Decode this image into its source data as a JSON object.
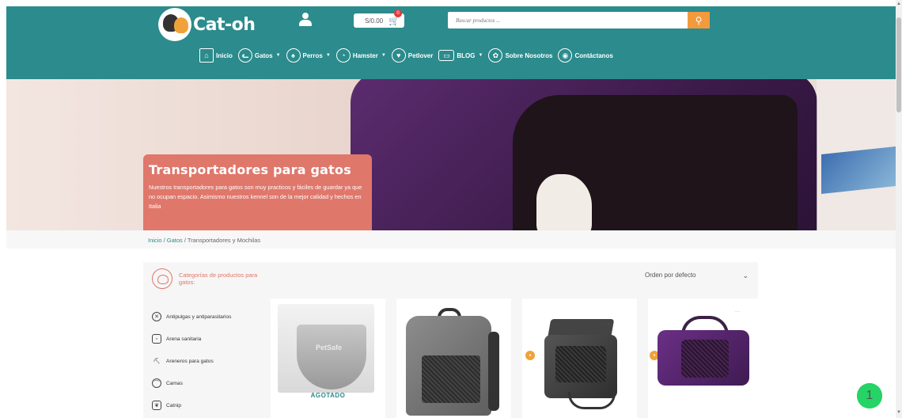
{
  "header": {
    "logo_text": "Cat-oh",
    "cart_total": "S/0.00",
    "cart_count": "0",
    "search_placeholder": "Buscar productos ...",
    "nav": [
      {
        "label": "Inicio",
        "icon": "house-icon",
        "has_dropdown": false
      },
      {
        "label": "Gatos",
        "icon": "cat-icon",
        "has_dropdown": true
      },
      {
        "label": "Perros",
        "icon": "dog-icon",
        "has_dropdown": true
      },
      {
        "label": "Hamster",
        "icon": "hamster-icon",
        "has_dropdown": true
      },
      {
        "label": "Petlover",
        "icon": "heart-icon",
        "has_dropdown": false
      },
      {
        "label": "BLOG",
        "icon": "laptop-icon",
        "has_dropdown": true
      },
      {
        "label": "Sobre Nosotros",
        "icon": "paw-icon",
        "has_dropdown": false
      },
      {
        "label": "Contáctanos",
        "icon": "location-pin-icon",
        "has_dropdown": false
      }
    ]
  },
  "hero": {
    "title": "Transportadores para gatos",
    "description": "Nuestros transportadores para gatos son muy practicos y fáciles de guardar ya que no ocupan espacio. Asimismo nuestros kennel son de la mejor calidad y hechos en Italia"
  },
  "breadcrumb": {
    "home": "Inicio",
    "sep1": " / ",
    "category": "Gatos",
    "sep2": " / ",
    "current": "Transportadores y Mochilas"
  },
  "sidebar": {
    "title": "Categorías de productos para gatos:",
    "items": [
      {
        "label": "Antipulgas y antiparasitarios",
        "icon": "bug-icon"
      },
      {
        "label": "Arena sanitaria",
        "icon": "litter-bag-icon"
      },
      {
        "label": "Areneros para gatos",
        "icon": "litter-tray-icon"
      },
      {
        "label": "Camas",
        "icon": "bed-icon"
      },
      {
        "label": "Catnip",
        "icon": "catnip-icon"
      }
    ]
  },
  "sort": {
    "selected": "Orden por defecto"
  },
  "products": [
    {
      "name": "PetSafe cat flap",
      "status": "AGOTADO"
    },
    {
      "name": "Grey backpack carrier",
      "status": ""
    },
    {
      "name": "Grey soft carrier",
      "status": ""
    },
    {
      "name": "Purple soft carrier",
      "status": ""
    }
  ],
  "whatsapp": {
    "badge": "1"
  },
  "colors": {
    "primary": "#2c8b8c",
    "accent": "#f39a3c",
    "hero_card": "#e0776b"
  }
}
